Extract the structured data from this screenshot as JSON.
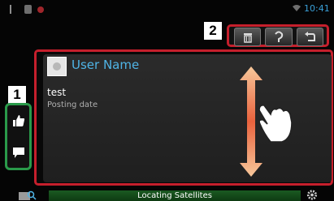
{
  "status_bar": {
    "time": "10:41",
    "icons": [
      "usb-icon",
      "sd-card-icon",
      "record-icon",
      "wifi-icon"
    ],
    "time_color": "#3aa0d8"
  },
  "callouts": {
    "one": "1",
    "two": "2"
  },
  "toolbar": {
    "buttons": [
      "trash-icon",
      "reply-icon",
      "back-icon"
    ]
  },
  "side_buttons": [
    "thumbs-up-icon",
    "comment-icon"
  ],
  "post": {
    "user_name": "User Name",
    "text": "test",
    "date_label": "Posting date"
  },
  "gesture": {
    "icon": "drag-up-down-hand-icon"
  },
  "bottom_bar": {
    "status": "Locating Satellites",
    "icons": [
      "search-icon",
      "gear-icon"
    ]
  },
  "colors": {
    "callout_red": "#c51f2c",
    "callout_green": "#2a9a4a",
    "accent_blue": "#4fb4e6",
    "status_green": "#1b5a22"
  }
}
